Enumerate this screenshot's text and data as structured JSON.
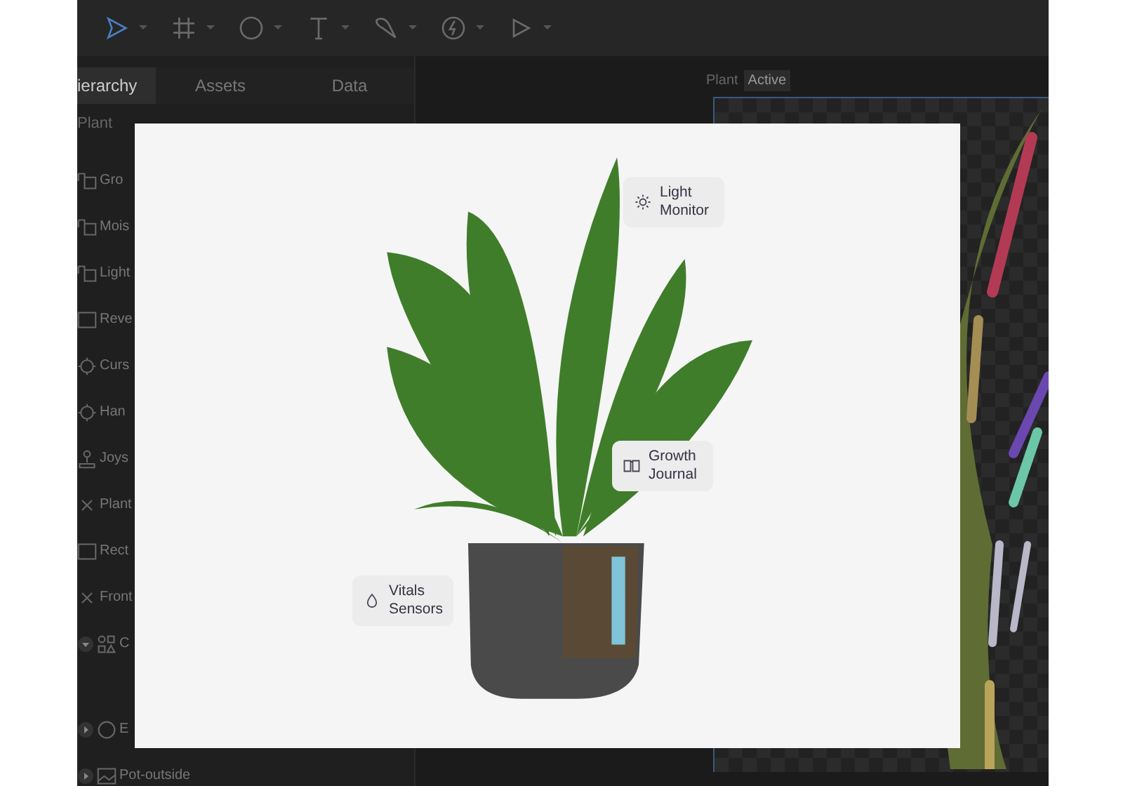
{
  "toolbar": {
    "tools": [
      {
        "kind": "pointer",
        "selected": true
      },
      {
        "kind": "frame",
        "selected": false
      },
      {
        "kind": "ellipse",
        "selected": false
      },
      {
        "kind": "text",
        "selected": false
      },
      {
        "kind": "pen",
        "selected": false
      },
      {
        "kind": "bolt",
        "selected": false
      },
      {
        "kind": "play",
        "selected": false
      }
    ]
  },
  "sidebar": {
    "tabs": [
      {
        "label": "ierarchy",
        "selected": true
      },
      {
        "label": "Assets",
        "selected": false
      },
      {
        "label": "Data",
        "selected": false
      }
    ],
    "root": "Plant",
    "items": [
      {
        "kind": "group",
        "label": "Gro"
      },
      {
        "kind": "group",
        "label": "Mois"
      },
      {
        "kind": "group",
        "label": "Light"
      },
      {
        "kind": "rect",
        "label": "Reve"
      },
      {
        "kind": "target",
        "label": "Curs"
      },
      {
        "kind": "target",
        "label": "Han"
      },
      {
        "kind": "joystick",
        "label": "Joys"
      },
      {
        "kind": "cross",
        "label": "Plant"
      },
      {
        "kind": "rect",
        "label": "Rect"
      },
      {
        "kind": "cross",
        "label": "Front"
      },
      {
        "kind": "shapes",
        "label": "C",
        "expanded": true
      },
      {
        "kind": "circle",
        "label": "E",
        "expanded": false
      },
      {
        "kind": "image",
        "label": "Pot-outside",
        "expanded": false
      }
    ]
  },
  "canvas": {
    "label": "Plant",
    "badge": "Active"
  },
  "card": {
    "callouts": [
      {
        "kind": "sun",
        "text": "Light Monitor"
      },
      {
        "kind": "book",
        "text": "Growth Journal"
      },
      {
        "kind": "drop",
        "text": "Vitals Sensors"
      }
    ]
  }
}
